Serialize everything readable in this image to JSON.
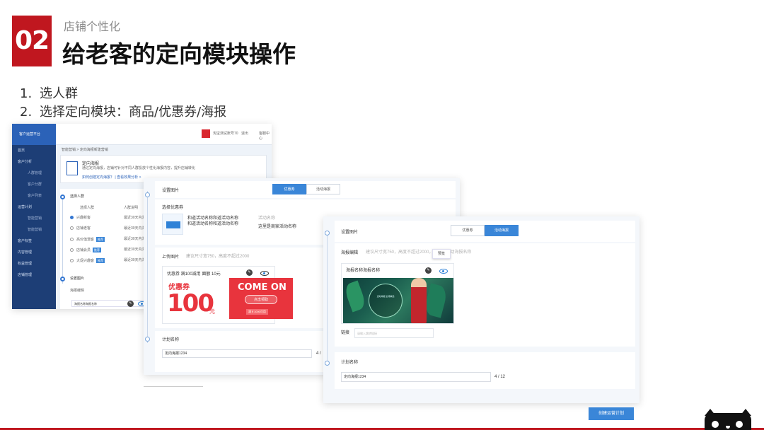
{
  "slide": {
    "number": "02",
    "subtitle": "店铺个性化",
    "title": "给老客的定向模块操作",
    "steps": [
      {
        "num": "1.",
        "text": "选人群"
      },
      {
        "num": "2.",
        "text": "选择定向模块：商品/优惠券/海报"
      }
    ]
  },
  "panelA": {
    "sidebar": {
      "header": "客户运营平台",
      "items": [
        "首页",
        "客户分析",
        "人群管理",
        "客户分群",
        "客户列表",
        "运营计划",
        "智能营销",
        "智能营销",
        "客户标签",
        "内容管理",
        "权益管理",
        "店铺管理"
      ]
    },
    "topbar": {
      "shop": "淘宝测试账号70",
      "exit": "退出",
      "help": "客服中心"
    },
    "breadcrumb": "智能营销 > 定向海报新建营销",
    "info": {
      "title": "定向海报",
      "desc": "通过定向海报，店铺可针对不同人群投放个性化海报内容，提升店铺转化",
      "links": "如何创建定向海报？ | 查看效果分析 >"
    },
    "step1_label": "选择人群",
    "columns": [
      "选择人群",
      "人群说明"
    ],
    "options": [
      {
        "label": "兴趣新客",
        "tag": ""
      },
      {
        "label": "店铺老客",
        "tag": ""
      },
      {
        "label": "高价值潜客",
        "tag": "推荐"
      },
      {
        "label": "店铺会员",
        "tag": "推荐"
      },
      {
        "label": "大促兴趣客",
        "tag": "推荐"
      }
    ],
    "option_desc": "最近30天内浏览过",
    "step2_label": "设置图片",
    "sub_label": "海报编辑",
    "poster_input": "海报名称海报名称"
  },
  "panelB": {
    "header": "设置图片",
    "tabs": [
      "优惠券",
      "活动海报"
    ],
    "choose_label": "选择优惠券",
    "coupon_desc_1": "和道活动名称和道活动名称",
    "coupon_desc_2": "和道活动名称和道活动名称",
    "col_label": "活动名称",
    "col_value": "这里是商家活动名称",
    "upload_label": "上传图片",
    "upload_hint": "建议尺寸宽750，高度不超过2000",
    "coupon_title": "优惠券  满100减用 面额 10元",
    "coupon_word": "优惠券",
    "coupon_value": "100",
    "coupon_unit": "元",
    "banner_text": "COME ON",
    "banner_btn": "点击领取",
    "banner_sub": "满￥1000可用",
    "plan_label": "计划名称",
    "plan_value": "定向海报1234",
    "plan_count": "4 /"
  },
  "panelC": {
    "header": "设置图片",
    "tabs": [
      "优惠券",
      "活动海报"
    ],
    "edit_label": "海报编辑",
    "edit_hint": "建议尺寸宽750，高度不超过2000，可设置活动海报名称",
    "tooltip": "预览",
    "poster_name": "海报名称海报名称",
    "poster_text": "活动海报 全场精选",
    "link_label": "链接",
    "link_placeholder": "请输入跳转链接",
    "plan_label": "计划名称",
    "plan_value": "定向海报1234",
    "plan_count": "4 / 12"
  },
  "create_button": "创建运营计划",
  "colors": {
    "brand_red": "#c0171f",
    "accent_blue": "#3a86d8",
    "sidebar_navy": "#1d3e76"
  }
}
